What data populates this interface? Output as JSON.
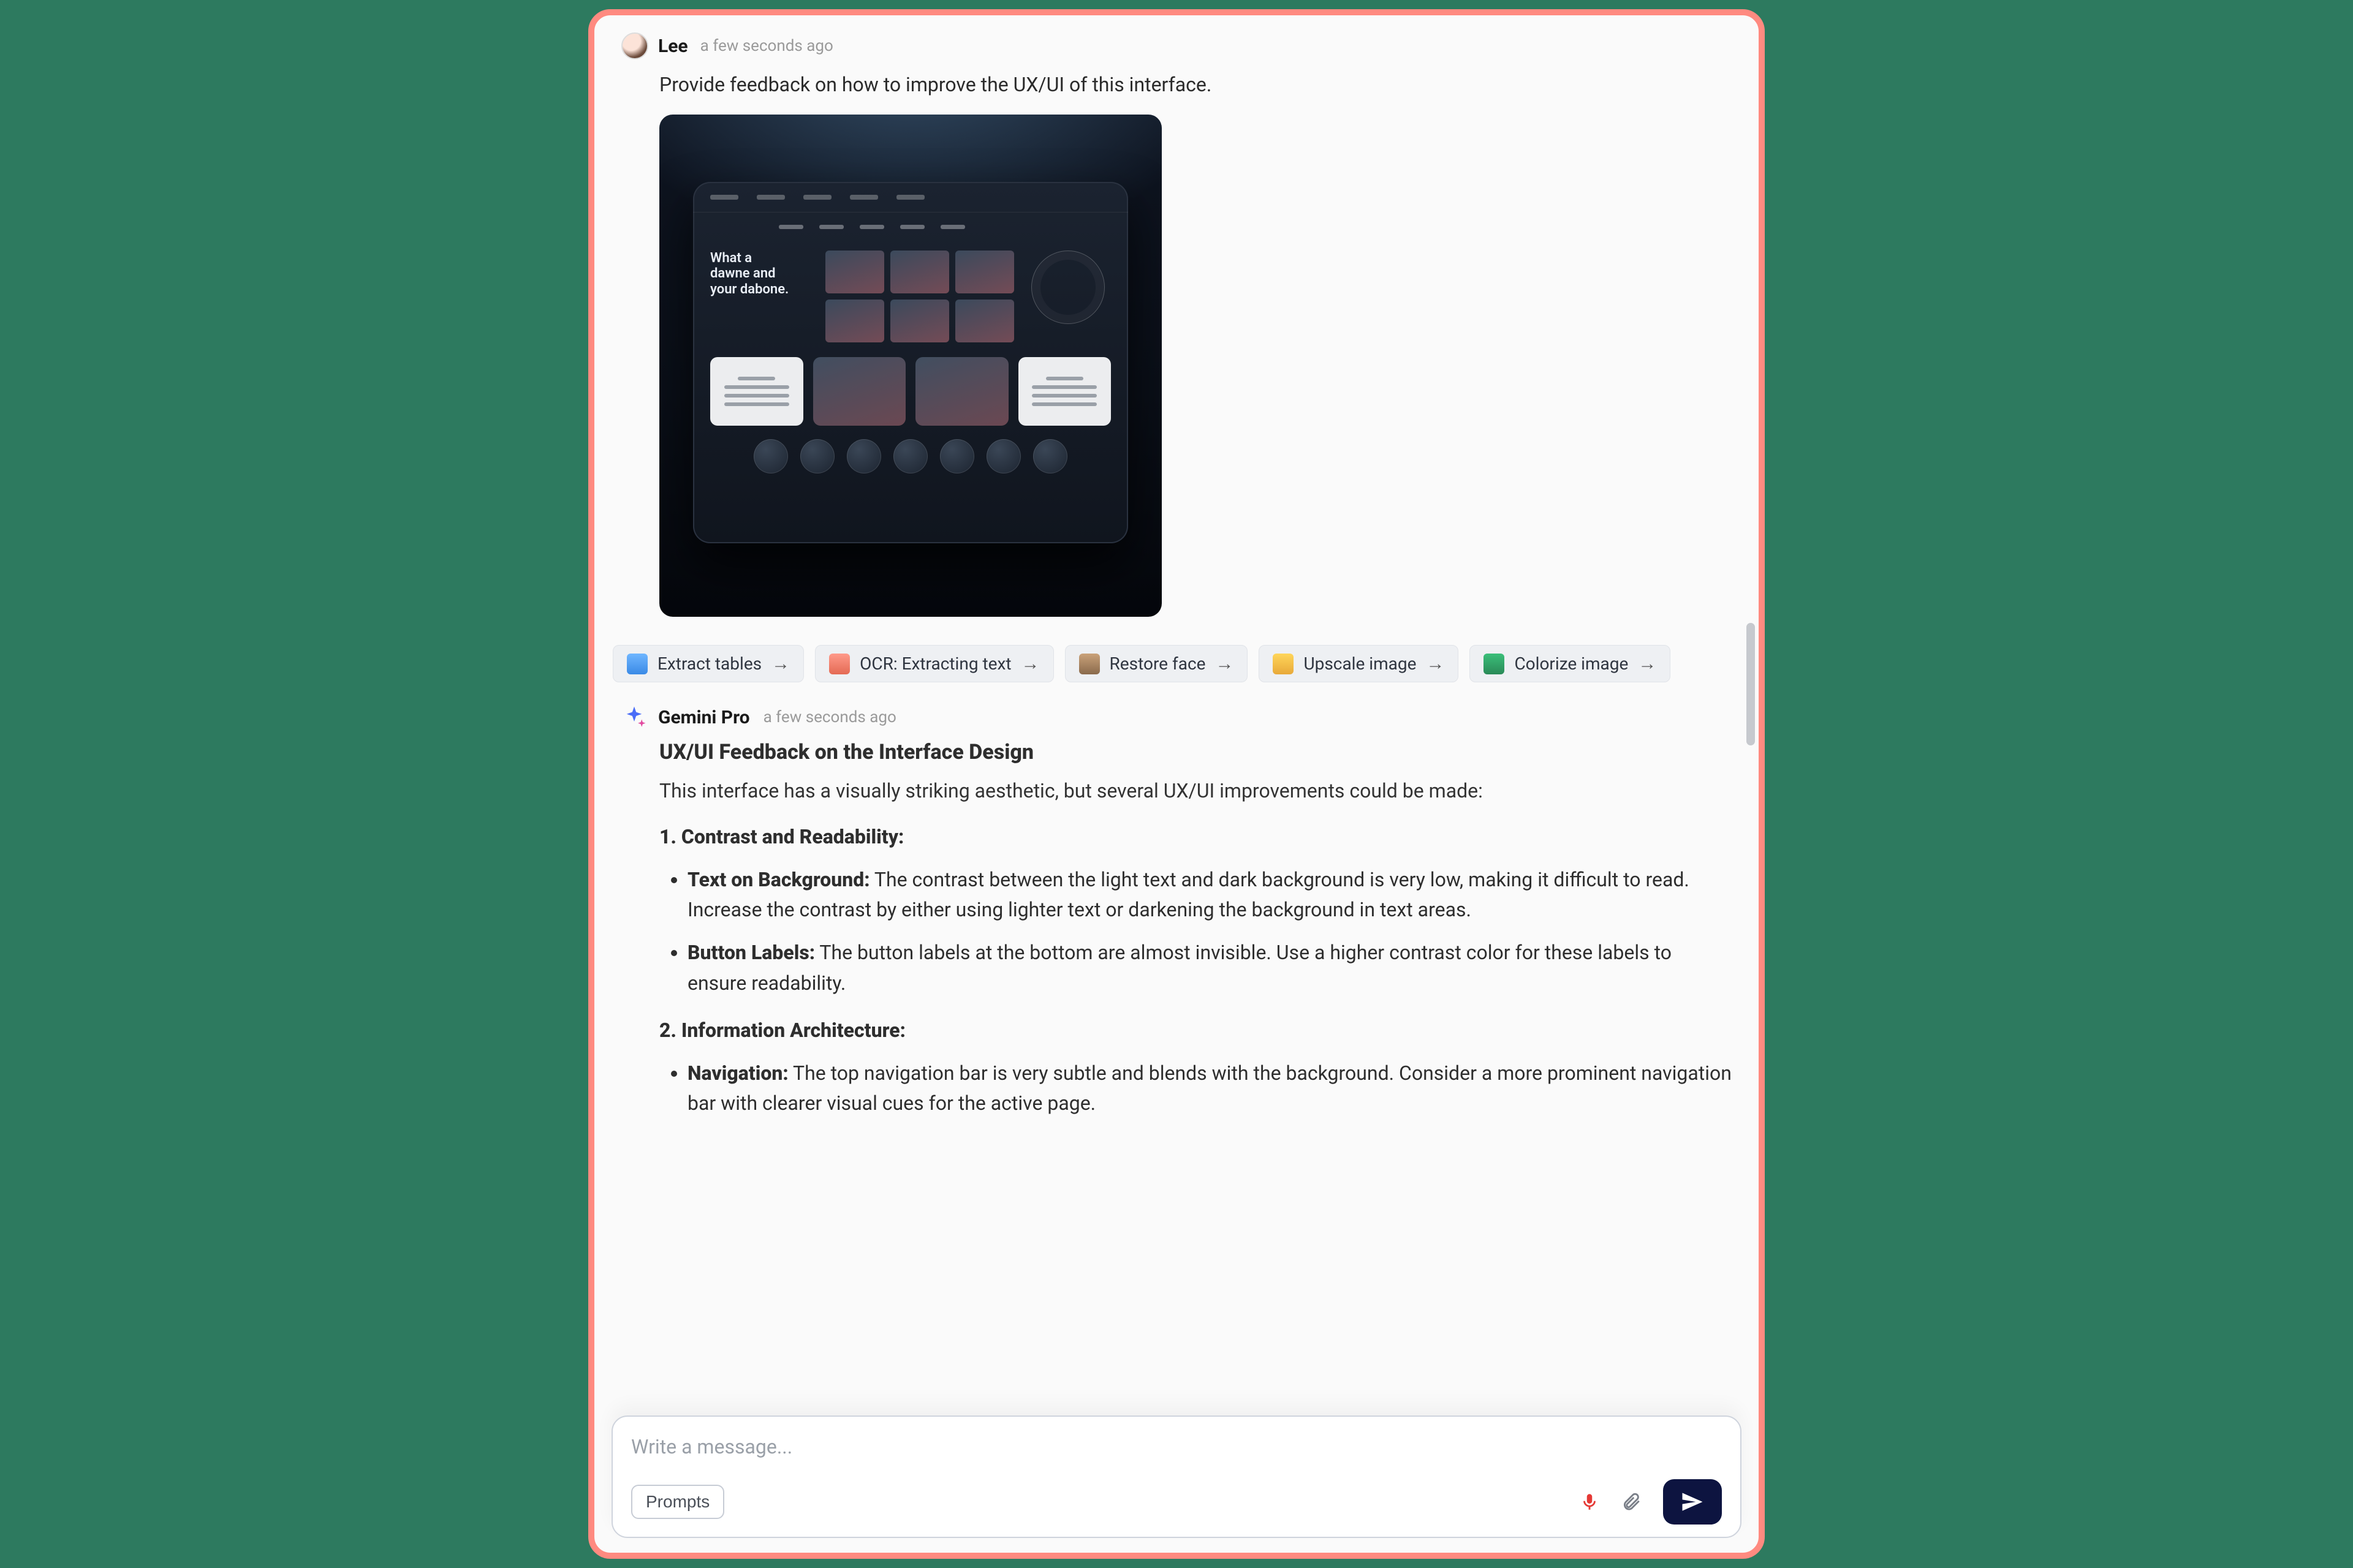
{
  "user": {
    "name": "Lee",
    "timestamp": "a few seconds ago",
    "prompt": "Provide feedback on how to improve the UX/UI of this interface.",
    "image_hero_text": "What a\ndawne and\nyour dabone."
  },
  "action_chips": [
    {
      "label": "Extract tables",
      "icon": "table"
    },
    {
      "label": "OCR: Extracting text",
      "icon": "ocr"
    },
    {
      "label": "Restore face",
      "icon": "face"
    },
    {
      "label": "Upscale image",
      "icon": "upscale"
    },
    {
      "label": "Colorize image",
      "icon": "color"
    }
  ],
  "assistant": {
    "name": "Gemini Pro",
    "timestamp": "a few seconds ago",
    "title": "UX/UI Feedback on the Interface Design",
    "intro": "This interface has a visually striking aesthetic, but several UX/UI improvements could be made:",
    "section1_title": "1. Contrast and Readability:",
    "s1_b1_label": "Text on Background:",
    "s1_b1_text": " The contrast between the light text and dark background is very low, making it difficult to read. Increase the contrast by either using lighter text or darkening the background in text areas.",
    "s1_b2_label": "Button Labels:",
    "s1_b2_text": " The button labels at the bottom are almost invisible. Use a higher contrast color for these labels to ensure readability.",
    "section2_title": "2. Information Architecture:",
    "s2_b1_label": "Navigation:",
    "s2_b1_text": " The top navigation bar is very subtle and blends with the background. Consider a more prominent navigation bar with clearer visual cues for the active page."
  },
  "composer": {
    "placeholder": "Write a message...",
    "prompts_button": "Prompts"
  }
}
